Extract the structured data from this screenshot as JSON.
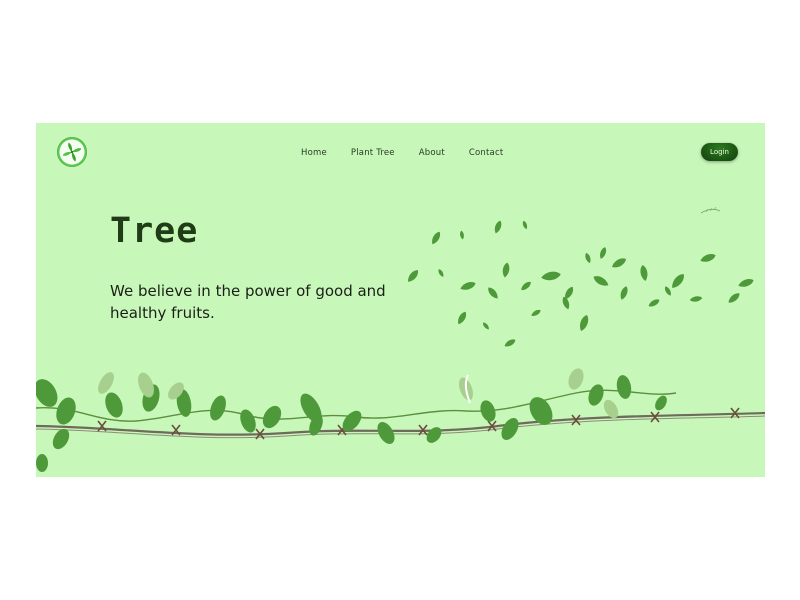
{
  "nav": {
    "items": [
      "Home",
      "Plant Tree",
      "About",
      "Contact"
    ]
  },
  "header": {
    "login_label": "Login"
  },
  "hero": {
    "title": "Tree",
    "tagline": "We believe in the power of good and healthy fruits."
  },
  "colors": {
    "background": "#c8f8b9",
    "accent": "#1d5a14",
    "text": "#1b1f18"
  },
  "icons": {
    "logo": "clover-icon"
  }
}
